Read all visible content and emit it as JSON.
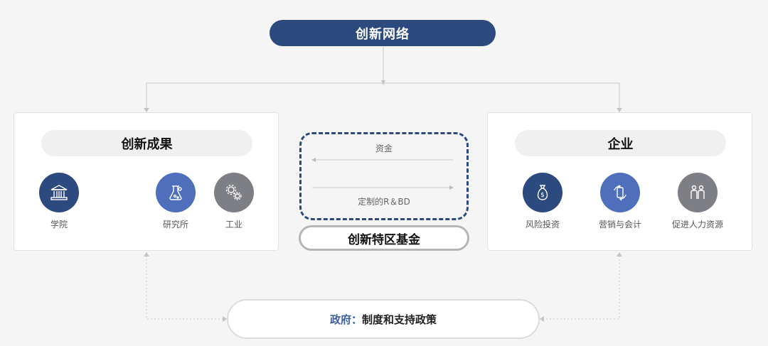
{
  "top": {
    "title": "创新网络"
  },
  "left_panel": {
    "title": "创新成果",
    "items": [
      {
        "label": "学院",
        "icon": "institution-building-icon",
        "color": "#2d4a7f"
      },
      {
        "label": "研究所",
        "icon": "lab-flask-icon",
        "color": "#4f6fbd"
      },
      {
        "label": "工业",
        "icon": "gears-icon",
        "color": "#7d7f85"
      }
    ]
  },
  "center": {
    "top_text": "资金",
    "bottom_text": "定制的R＆BD",
    "fund_title": "创新特区基金"
  },
  "right_panel": {
    "title": "企业",
    "items": [
      {
        "label": "风险投资",
        "icon": "money-bag-icon",
        "color": "#2d4a7f"
      },
      {
        "label": "营销与会计",
        "icon": "mobile-cycle-icon",
        "color": "#4f6fbd"
      },
      {
        "label": "促进人力资源",
        "icon": "people-icon",
        "color": "#7d7f85"
      }
    ]
  },
  "bottom": {
    "accent": "政府",
    "separator": "：",
    "text": "制度和支持政策"
  },
  "colors": {
    "primary": "#2d4a7f",
    "secondary": "#4f6fbd",
    "gray": "#7d7f85"
  }
}
